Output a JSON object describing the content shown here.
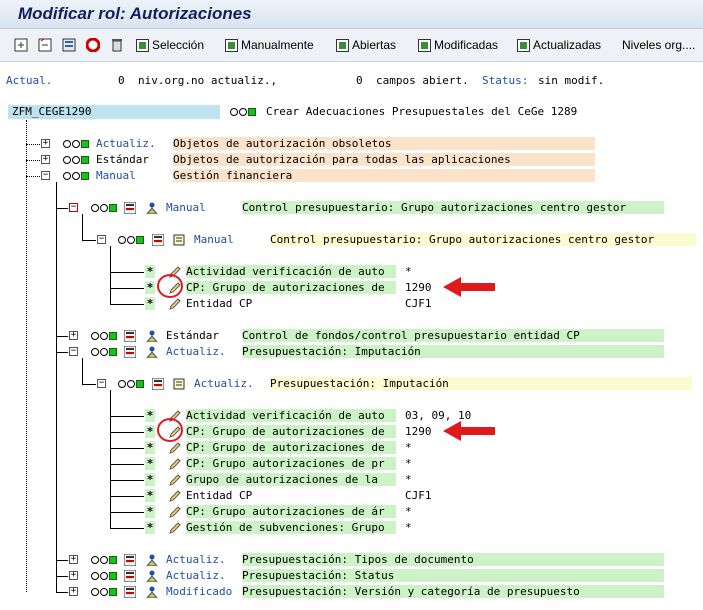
{
  "window": {
    "title": "Modificar rol: Autorizaciones"
  },
  "toolbar": {
    "buttons": [
      "Selección",
      "Manualmente",
      "Abiertas",
      "Modificadas",
      "Actualizadas",
      "Niveles org...."
    ]
  },
  "status": {
    "actual_label": "Actual.",
    "count1": "0",
    "text1": "niv.org.no actualiz.,",
    "count2": "0",
    "text2": "campos abiert.",
    "status_label": "Status:",
    "status_value": "sin modif."
  },
  "tree": {
    "root": {
      "name": "ZFM_CEGE1290",
      "description": "Crear Adecuaciones Presupuestales del CeGe 1289"
    },
    "level1": [
      {
        "status": "Actualiz.",
        "description": "Objetos de autorización obsoletos"
      },
      {
        "status": "Estándar",
        "description": "Objetos de autorización para todas las aplicaciones"
      },
      {
        "status": "Manual",
        "description": "Gestión financiera"
      }
    ],
    "group_a": {
      "status": "Manual",
      "description": "Control presupuestario: Grupo autorizaciones centro gestor",
      "object": {
        "status": "Manual",
        "description": "Control presupuestario: Grupo autorizaciones centro gestor"
      },
      "fields": [
        {
          "label": "Actividad verificación de auto",
          "value": "*"
        },
        {
          "label": "CP: Grupo de autorizaciones de",
          "value": "1290"
        },
        {
          "label": "Entidad CP",
          "value": "CJF1"
        }
      ]
    },
    "group_b": {
      "status": "Estándar",
      "description": "Control de fondos/control presupuestario entidad CP"
    },
    "group_c": {
      "status": "Actualiz.",
      "description": "Presupuestación: Imputación",
      "object": {
        "status": "Actualiz.",
        "description": "Presupuestación: Imputación"
      },
      "fields": [
        {
          "label": "Actividad verificación de auto",
          "value": "03, 09, 10"
        },
        {
          "label": "CP: Grupo de autorizaciones de",
          "value": "1290"
        },
        {
          "label": "CP: Grupo de autorizaciones de",
          "value": "*"
        },
        {
          "label": "CP: Grupo autorizaciones de pr",
          "value": "*"
        },
        {
          "label": "Grupo de autorizaciones de la",
          "value": "*"
        },
        {
          "label": "Entidad CP",
          "value": "CJF1"
        },
        {
          "label": "CP: Grupo autorizaciones de ár",
          "value": "*"
        },
        {
          "label": "Gestión de subvenciones: Grupo",
          "value": "*"
        }
      ]
    },
    "bottom": [
      {
        "status": "Actualiz.",
        "description": "Presupuestación: Tipos de documento"
      },
      {
        "status": "Actualiz.",
        "description": "Presupuestación: Status"
      },
      {
        "status": "Modificado",
        "description": "Presupuestación: Versión y categoría de presupuesto"
      }
    ]
  },
  "colors": {
    "annotation": "#e01a1a",
    "field_green": "#cdf2c7",
    "text_orange": "#fbe3cb",
    "status_blue": "#1f4fa0"
  }
}
